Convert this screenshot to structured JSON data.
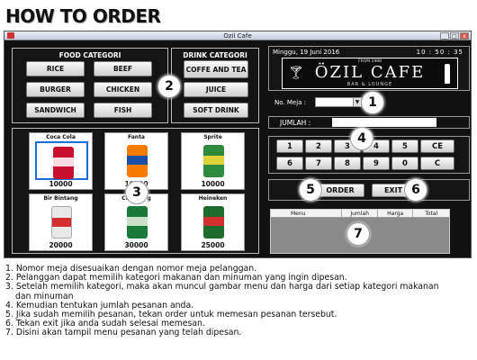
{
  "heading": "HOW TO ORDER",
  "window": {
    "title": "Ozil Cafe",
    "controls": [
      "_",
      "□",
      "x"
    ]
  },
  "food": {
    "title": "FOOD CATEGORI",
    "buttons": [
      "RICE",
      "BEEF",
      "BURGER",
      "CHICKEN",
      "SANDWICH",
      "FISH"
    ]
  },
  "drink": {
    "title": "DRINK CATEGORI",
    "buttons": [
      "COFFE AND TEA",
      "JUICE",
      "SOFT DRINK"
    ]
  },
  "menu_cards": [
    {
      "name": "Coca Cola",
      "price": "10000",
      "color": "#c8102e",
      "selected": true
    },
    {
      "name": "Fanta",
      "price": "10000",
      "color": "#f57c00",
      "selected": false
    },
    {
      "name": "Sprite",
      "price": "10000",
      "color": "#2e8b3e",
      "selected": false
    },
    {
      "name": "Bir Bintang",
      "price": "20000",
      "color": "#d32f2f",
      "selected": false
    },
    {
      "name": "Carlsberg",
      "price": "30000",
      "color": "#1b7a3a",
      "selected": false
    },
    {
      "name": "Heineken",
      "price": "25000",
      "color": "#1e6b2e",
      "selected": false
    }
  ],
  "header": {
    "date": "Minggu, 19 Juni 2016",
    "time": "10 : 50 : 35"
  },
  "logo": {
    "top": "FROM 1988",
    "name": "ÖZIL CAFE",
    "sub": "BAR & LOUNGE"
  },
  "table_no": {
    "label": "No. Meja :",
    "value": ""
  },
  "jumlah": {
    "label": "JUMLAH :",
    "value": ""
  },
  "keypad": [
    [
      "1",
      "2",
      "3",
      "4",
      "5",
      "CE"
    ],
    [
      "6",
      "7",
      "8",
      "9",
      "0",
      "C"
    ]
  ],
  "actions": {
    "order": "ORDER",
    "exit": "EXIT"
  },
  "order_table": {
    "columns": [
      "Menu",
      "Jumlah",
      "Harga",
      "Total"
    ]
  },
  "callouts": [
    "1",
    "2",
    "3",
    "4",
    "5",
    "6",
    "7"
  ],
  "instructions": [
    "1. Nomor meja disesuaikan dengan nomor meja pelanggan.",
    "2. Pelanggan dapat memilih kategori makanan dan minuman yang ingin dipesan.",
    "3. Setelah memilih kategori, maka akan muncul gambar menu dan harga dari setiap kategori makanan",
    "dan minuman",
    "4. Kemudian tentukan jumlah pesanan anda.",
    "5. Jika sudah memilih pesanan, tekan order untuk memesan pesanan tersebut.",
    "6. Tekan exit jika anda sudah selesai memesan.",
    "7. Disini akan tampil menu pesanan yang telah dipesan."
  ]
}
